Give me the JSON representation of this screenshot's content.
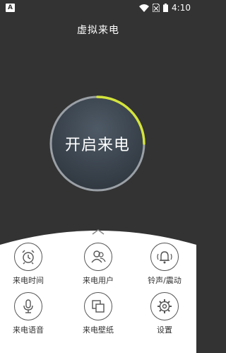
{
  "status_bar": {
    "app_badge": "A",
    "time": "4:10"
  },
  "title": "虚拟来电",
  "dial": {
    "label": "开启来电",
    "accent_color": "#d4e43c"
  },
  "menu": {
    "items": [
      {
        "label": "来电时间",
        "icon": "alarm-clock-icon"
      },
      {
        "label": "来电用户",
        "icon": "user-contact-icon"
      },
      {
        "label": "铃声/震动",
        "icon": "bell-vibrate-icon"
      },
      {
        "label": "来电语音",
        "icon": "microphone-icon"
      },
      {
        "label": "来电壁纸",
        "icon": "wallpaper-icon"
      },
      {
        "label": "设置",
        "icon": "gear-icon"
      }
    ]
  }
}
